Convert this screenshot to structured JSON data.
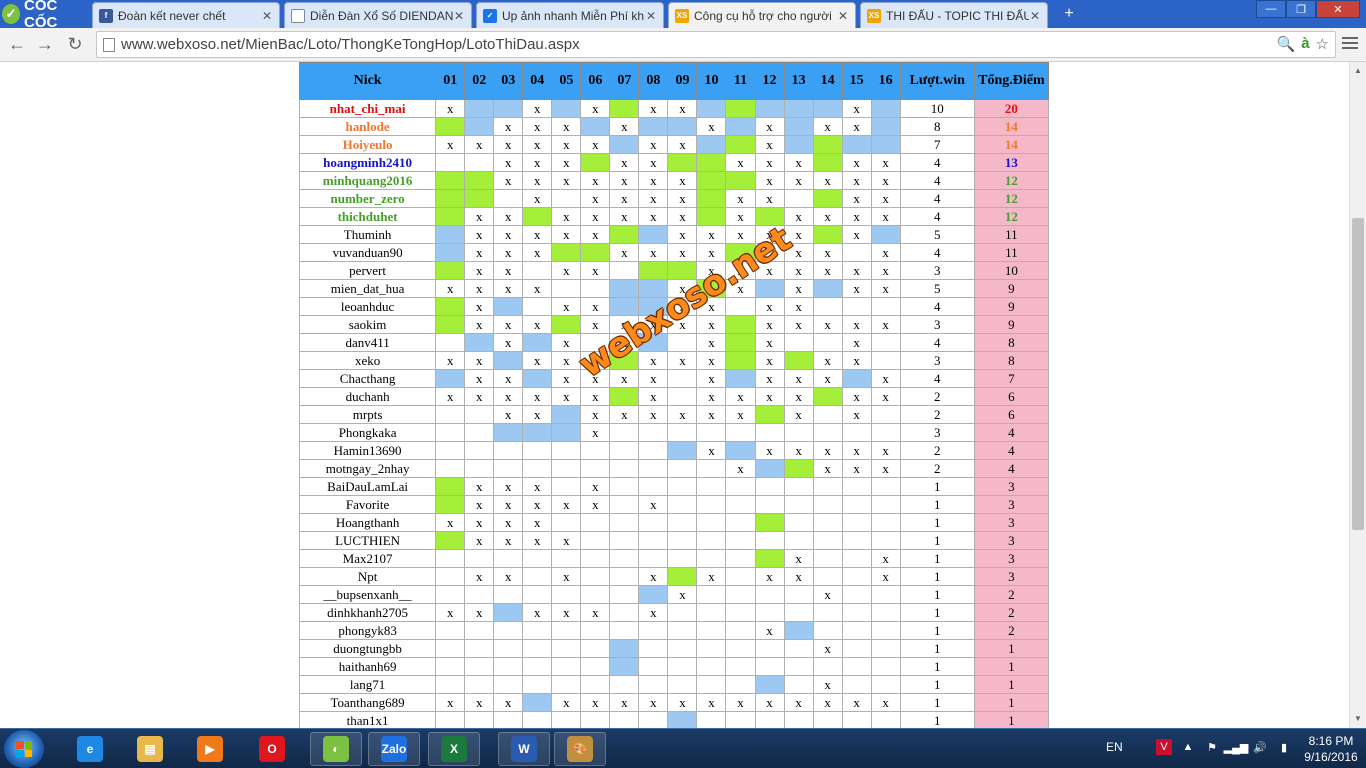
{
  "browser": {
    "brand": "CỐC CỐC",
    "tabs": [
      {
        "title": "Đoàn kết never chết",
        "icon": "facebook-icon",
        "color": "#3b5998",
        "glyph": "f"
      },
      {
        "title": "Diễn Đàn Xổ Số DIENDAN",
        "icon": "document-icon",
        "color": "#ffffff",
        "glyph": ""
      },
      {
        "title": "Up ảnh nhanh Miễn Phí kh",
        "icon": "checkbox-icon",
        "color": "#1a73e8",
        "glyph": "✓"
      },
      {
        "title": "Công cụ hỗ trợ cho người",
        "icon": "xs-logo-icon",
        "color": "#f0a500",
        "glyph": "XS",
        "active": true
      },
      {
        "title": "THI ĐẤU - TOPIC THI ĐẤU",
        "icon": "xs-logo-icon",
        "color": "#f0a500",
        "glyph": "XS"
      }
    ],
    "new_tab": "+",
    "window_buttons": [
      "—",
      "❐",
      "✕"
    ],
    "url": "www.webxoso.net/MienBac/Loto/ThongKeTongHop/LotoThiDau.aspx"
  },
  "table": {
    "headers": [
      "Nick",
      "01",
      "02",
      "03",
      "04",
      "05",
      "06",
      "07",
      "08",
      "09",
      "10",
      "11",
      "12",
      "13",
      "14",
      "15",
      "16",
      "Lượt.win",
      "Tổng.Điểm"
    ],
    "rows": [
      {
        "nick": "nhat_chi_mai",
        "color": "#e01010",
        "cells": [
          "x",
          "b",
          "b",
          "x",
          "b",
          "x",
          "g",
          "x",
          "x",
          "b",
          "g",
          "b",
          "b",
          "b",
          "x",
          "b"
        ],
        "wins": "10",
        "total": "20"
      },
      {
        "nick": "hanlode",
        "color": "#f07830",
        "cells": [
          "g",
          "b",
          "x",
          "x",
          "x",
          "b",
          "x",
          "b",
          "b",
          "x",
          "b",
          "x",
          "b",
          "x",
          "x",
          "b"
        ],
        "wins": "8",
        "total": "14"
      },
      {
        "nick": "Hoiyeulo",
        "color": "#f07830",
        "cells": [
          "x",
          "x",
          "x",
          "x",
          "x",
          "x",
          "b",
          "x",
          "x",
          "b",
          "g",
          "x",
          "b",
          "g",
          "b",
          "b"
        ],
        "wins": "7",
        "total": "14"
      },
      {
        "nick": "hoangminh2410",
        "color": "#1414c8",
        "cells": [
          "",
          "",
          "x",
          "x",
          "x",
          "g",
          "x",
          "x",
          "g",
          "g",
          "x",
          "x",
          "x",
          "g",
          "x",
          "x"
        ],
        "wins": "4",
        "total": "13"
      },
      {
        "nick": "minhquang2016",
        "color": "#46a028",
        "cells": [
          "g",
          "g",
          "x",
          "x",
          "x",
          "x",
          "x",
          "x",
          "x",
          "g",
          "g",
          "x",
          "x",
          "x",
          "x",
          "x"
        ],
        "wins": "4",
        "total": "12"
      },
      {
        "nick": "number_zero",
        "color": "#46a028",
        "cells": [
          "g",
          "g",
          "",
          "x",
          "",
          "x",
          "x",
          "x",
          "x",
          "g",
          "x",
          "x",
          "",
          "g",
          "x",
          "x"
        ],
        "wins": "4",
        "total": "12"
      },
      {
        "nick": "thichduhet",
        "color": "#46a028",
        "cells": [
          "g",
          "x",
          "x",
          "g",
          "x",
          "x",
          "x",
          "x",
          "x",
          "g",
          "x",
          "g",
          "x",
          "x",
          "x",
          "x"
        ],
        "wins": "4",
        "total": "12"
      },
      {
        "nick": "Thuminh",
        "color": "#000000",
        "cells": [
          "b",
          "x",
          "x",
          "x",
          "x",
          "x",
          "g",
          "b",
          "x",
          "x",
          "x",
          "x",
          "x",
          "g",
          "x",
          "b"
        ],
        "wins": "5",
        "total": "11"
      },
      {
        "nick": "vuvanduan90",
        "color": "#000000",
        "cells": [
          "b",
          "x",
          "x",
          "x",
          "g",
          "g",
          "x",
          "x",
          "x",
          "x",
          "g",
          "",
          "x",
          "x",
          "",
          "x"
        ],
        "wins": "4",
        "total": "11"
      },
      {
        "nick": "pervert",
        "color": "#000000",
        "cells": [
          "g",
          "x",
          "x",
          "",
          "x",
          "x",
          "",
          "g",
          "g",
          "x",
          "x",
          "x",
          "x",
          "x",
          "x",
          "x"
        ],
        "wins": "3",
        "total": "10"
      },
      {
        "nick": "mien_dat_hua",
        "color": "#000000",
        "cells": [
          "x",
          "x",
          "x",
          "x",
          "",
          "",
          "b",
          "b",
          "x",
          "g",
          "x",
          "b",
          "x",
          "b",
          "x",
          "x"
        ],
        "wins": "5",
        "total": "9"
      },
      {
        "nick": "leoanhduc",
        "color": "#000000",
        "cells": [
          "g",
          "x",
          "b",
          "",
          "x",
          "x",
          "b",
          "b",
          "x",
          "x",
          "",
          "x",
          "x",
          "",
          "",
          ""
        ],
        "wins": "4",
        "total": "9"
      },
      {
        "nick": "saokim",
        "color": "#000000",
        "cells": [
          "g",
          "x",
          "x",
          "x",
          "g",
          "x",
          "x",
          "x",
          "x",
          "x",
          "g",
          "x",
          "x",
          "x",
          "x",
          "x"
        ],
        "wins": "3",
        "total": "9"
      },
      {
        "nick": "danv411",
        "color": "#000000",
        "cells": [
          "",
          "b",
          "x",
          "b",
          "x",
          "",
          "x",
          "b",
          "",
          "x",
          "g",
          "x",
          "",
          "",
          "x",
          ""
        ],
        "wins": "4",
        "total": "8"
      },
      {
        "nick": "xeko",
        "color": "#000000",
        "cells": [
          "x",
          "x",
          "b",
          "x",
          "x",
          "x",
          "g",
          "x",
          "x",
          "x",
          "g",
          "x",
          "g",
          "x",
          "x",
          ""
        ],
        "wins": "3",
        "total": "8"
      },
      {
        "nick": "Chacthang",
        "color": "#000000",
        "cells": [
          "b",
          "x",
          "x",
          "b",
          "x",
          "x",
          "x",
          "x",
          "",
          "x",
          "b",
          "x",
          "x",
          "x",
          "b",
          "x"
        ],
        "wins": "4",
        "total": "7"
      },
      {
        "nick": "duchanh",
        "color": "#000000",
        "cells": [
          "x",
          "x",
          "x",
          "x",
          "x",
          "x",
          "g",
          "x",
          "",
          "x",
          "x",
          "x",
          "x",
          "g",
          "x",
          "x"
        ],
        "wins": "2",
        "total": "6"
      },
      {
        "nick": "mrpts",
        "color": "#000000",
        "cells": [
          "",
          "",
          "x",
          "x",
          "b",
          "x",
          "x",
          "x",
          "x",
          "x",
          "x",
          "g",
          "x",
          "",
          "x",
          ""
        ],
        "wins": "2",
        "total": "6"
      },
      {
        "nick": "Phongkaka",
        "color": "#000000",
        "cells": [
          "",
          "",
          "b",
          "b",
          "b",
          "x",
          "",
          "",
          "",
          "",
          "",
          "",
          "",
          "",
          "",
          ""
        ],
        "wins": "3",
        "total": "4"
      },
      {
        "nick": "Hamin13690",
        "color": "#000000",
        "cells": [
          "",
          "",
          "",
          "",
          "",
          "",
          "",
          "",
          "b",
          "x",
          "b",
          "x",
          "x",
          "x",
          "x",
          "x"
        ],
        "wins": "2",
        "total": "4"
      },
      {
        "nick": "motngay_2nhay",
        "color": "#000000",
        "cells": [
          "",
          "",
          "",
          "",
          "",
          "",
          "",
          "",
          "",
          "",
          "x",
          "b",
          "g",
          "x",
          "x",
          "x"
        ],
        "wins": "2",
        "total": "4"
      },
      {
        "nick": "BaiDauLamLai",
        "color": "#000000",
        "cells": [
          "g",
          "x",
          "x",
          "x",
          "",
          "x",
          "",
          "",
          "",
          "",
          "",
          "",
          "",
          "",
          "",
          ""
        ],
        "wins": "1",
        "total": "3"
      },
      {
        "nick": "Favorite",
        "color": "#000000",
        "cells": [
          "g",
          "x",
          "x",
          "x",
          "x",
          "x",
          "",
          "x",
          "",
          "",
          "",
          "",
          "",
          "",
          "",
          ""
        ],
        "wins": "1",
        "total": "3"
      },
      {
        "nick": "Hoangthanh",
        "color": "#000000",
        "cells": [
          "x",
          "x",
          "x",
          "x",
          "",
          "",
          "",
          "",
          "",
          "",
          "",
          "g",
          "",
          "",
          "",
          ""
        ],
        "wins": "1",
        "total": "3"
      },
      {
        "nick": "LUCTHIEN",
        "color": "#000000",
        "cells": [
          "g",
          "x",
          "x",
          "x",
          "x",
          "",
          "",
          "",
          "",
          "",
          "",
          "",
          "",
          "",
          "",
          ""
        ],
        "wins": "1",
        "total": "3"
      },
      {
        "nick": "Max2107",
        "color": "#000000",
        "cells": [
          "",
          "",
          "",
          "",
          "",
          "",
          "",
          "",
          "",
          "",
          "",
          "g",
          "x",
          "",
          "",
          "x"
        ],
        "wins": "1",
        "total": "3"
      },
      {
        "nick": "Npt",
        "color": "#000000",
        "cells": [
          "",
          "x",
          "x",
          "",
          "x",
          "",
          "",
          "x",
          "g",
          "x",
          "",
          "x",
          "x",
          "",
          "",
          "x"
        ],
        "wins": "1",
        "total": "3"
      },
      {
        "nick": "__bupsenxanh__",
        "color": "#000000",
        "cells": [
          "",
          "",
          "",
          "",
          "",
          "",
          "",
          "b",
          "x",
          "",
          "",
          "",
          "",
          "x",
          "",
          ""
        ],
        "wins": "1",
        "total": "2"
      },
      {
        "nick": "dinhkhanh2705",
        "color": "#000000",
        "cells": [
          "x",
          "x",
          "b",
          "x",
          "x",
          "x",
          "",
          "x",
          "",
          "",
          "",
          "",
          "",
          "",
          "",
          ""
        ],
        "wins": "1",
        "total": "2"
      },
      {
        "nick": "phongyk83",
        "color": "#000000",
        "cells": [
          "",
          "",
          "",
          "",
          "",
          "",
          "",
          "",
          "",
          "",
          "",
          "x",
          "b",
          "",
          "",
          ""
        ],
        "wins": "1",
        "total": "2"
      },
      {
        "nick": "duongtungbb",
        "color": "#000000",
        "cells": [
          "",
          "",
          "",
          "",
          "",
          "",
          "b",
          "",
          "",
          "",
          "",
          "",
          "",
          "x",
          "",
          ""
        ],
        "wins": "1",
        "total": "1"
      },
      {
        "nick": "haithanh69",
        "color": "#000000",
        "cells": [
          "",
          "",
          "",
          "",
          "",
          "",
          "b",
          "",
          "",
          "",
          "",
          "",
          "",
          "",
          "",
          ""
        ],
        "wins": "1",
        "total": "1"
      },
      {
        "nick": "lang71",
        "color": "#000000",
        "cells": [
          "",
          "",
          "",
          "",
          "",
          "",
          "",
          "",
          "",
          "",
          "",
          "b",
          "",
          "x",
          "",
          ""
        ],
        "wins": "1",
        "total": "1"
      },
      {
        "nick": "Toanthang689",
        "color": "#000000",
        "cells": [
          "x",
          "x",
          "x",
          "b",
          "x",
          "x",
          "x",
          "x",
          "x",
          "x",
          "x",
          "x",
          "x",
          "x",
          "x",
          "x"
        ],
        "wins": "1",
        "total": "1"
      },
      {
        "nick": "than1x1",
        "color": "#000000",
        "cells": [
          "",
          "",
          "",
          "",
          "",
          "",
          "",
          "",
          "b",
          "",
          "",
          "",
          "",
          "",
          "",
          ""
        ],
        "wins": "1",
        "total": "1"
      }
    ]
  },
  "watermark": "webxoso.net",
  "taskbar": {
    "apps": [
      {
        "name": "internet-explorer-icon",
        "color": "#1e88e5",
        "glyph": "e"
      },
      {
        "name": "file-explorer-icon",
        "color": "#e8b84a",
        "glyph": "▤"
      },
      {
        "name": "media-player-icon",
        "color": "#f07a1a",
        "glyph": "▶"
      },
      {
        "name": "opera-icon",
        "color": "#e0161e",
        "glyph": "O"
      },
      {
        "name": "coccoc-icon",
        "color": "#7cc242",
        "glyph": "◐",
        "active": true
      },
      {
        "name": "zalo-icon",
        "color": "#1e6fe0",
        "glyph": "Zalo"
      },
      {
        "name": "excel-icon",
        "color": "#1d7a3e",
        "glyph": "X"
      },
      {
        "name": "word-icon",
        "color": "#2a5bb0",
        "glyph": "W"
      },
      {
        "name": "paint-icon",
        "color": "#c09040",
        "glyph": "🎨"
      }
    ],
    "lang": "EN",
    "time": "8:16 PM",
    "date": "9/16/2016"
  }
}
